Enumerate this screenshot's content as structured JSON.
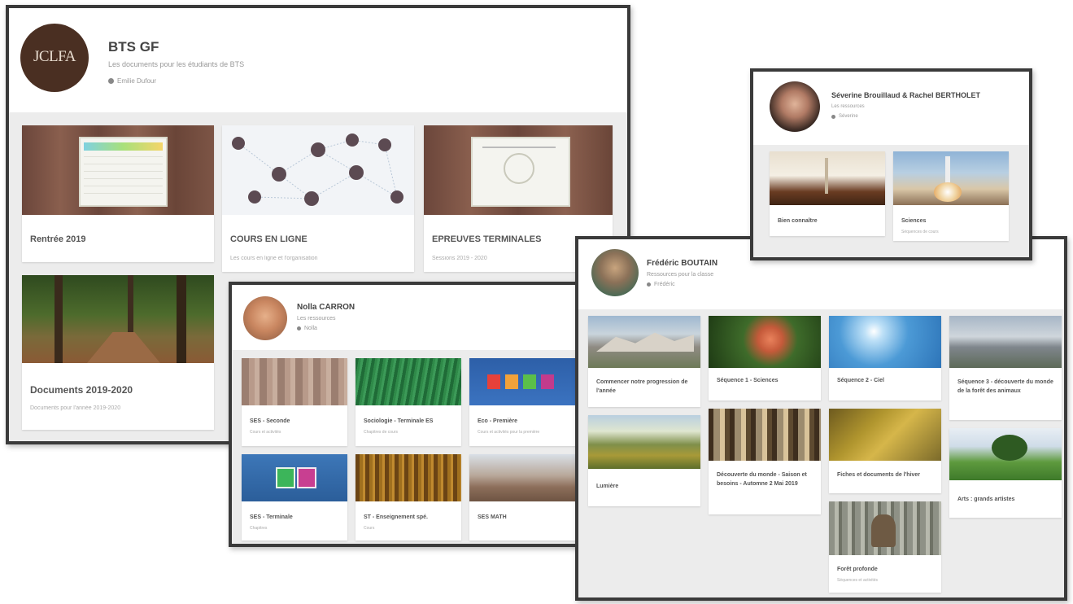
{
  "panel_a": {
    "avatar_text": "JCLFA",
    "title": "BTS GF",
    "subtitle": "Les documents pour les étudiants de BTS",
    "meta": "Emilie Dufour",
    "cards": [
      {
        "title": "Rentrée 2019",
        "sub": ""
      },
      {
        "title": "COURS EN LIGNE",
        "sub": "Les cours en ligne et l'organisation"
      },
      {
        "title": "EPREUVES TERMINALES",
        "sub": "Sessions 2019 - 2020"
      },
      {
        "title": "Documents 2019-2020",
        "sub": "Documents pour l'année 2019-2020"
      }
    ]
  },
  "panel_b": {
    "title": "Nolla CARRON",
    "subtitle": "Les ressources",
    "meta": "Nolla",
    "cards": [
      {
        "title": "SES - Seconde",
        "sub": "Cours et activités"
      },
      {
        "title": "Sociologie - Terminale ES",
        "sub": "Chapitres de cours"
      },
      {
        "title": "Eco - Première",
        "sub": "Cours et activités pour la première"
      },
      {
        "title": "SES - Terminale",
        "sub": "Chapitres"
      },
      {
        "title": "ST - Enseignement spé.",
        "sub": "Cours"
      },
      {
        "title": "SES MATH",
        "sub": ""
      }
    ]
  },
  "panel_c": {
    "title": "Frédéric BOUTAIN",
    "subtitle": "Ressources pour la classe",
    "meta": "Frédéric",
    "col1": [
      {
        "title": "Commencer notre progression de l'année",
        "sub": ""
      },
      {
        "title": "Lumière",
        "sub": ""
      }
    ],
    "col2": [
      {
        "title": "Séquence 1 - Sciences",
        "sub": ""
      },
      {
        "title": "Découverte du monde - Saison et besoins - Automne 2 Mai 2019",
        "sub": ""
      }
    ],
    "col3": [
      {
        "title": "Séquence 2 - Ciel",
        "sub": ""
      },
      {
        "title": "Fiches et documents de l'hiver",
        "sub": ""
      },
      {
        "title": "Forêt profonde",
        "sub": "Séquences et activités"
      }
    ],
    "col4": [
      {
        "title": "Séquence 3 - découverte du monde de la forêt des animaux",
        "sub": ""
      },
      {
        "title": "Arts : grands artistes",
        "sub": ""
      }
    ]
  },
  "panel_d": {
    "title": "Séverine Brouillaud & Rachel BERTHOLET",
    "subtitle": "Les ressources",
    "meta": "Séverine",
    "cards": [
      {
        "title": "Bien connaître",
        "sub": ""
      },
      {
        "title": "Sciences",
        "sub": "Séquences de cours"
      }
    ]
  },
  "colors": {
    "frame": "#3a3a3a",
    "panel_bg": "#ececec",
    "avatar_a": "#4a2f22",
    "wood": "#7a5344"
  }
}
